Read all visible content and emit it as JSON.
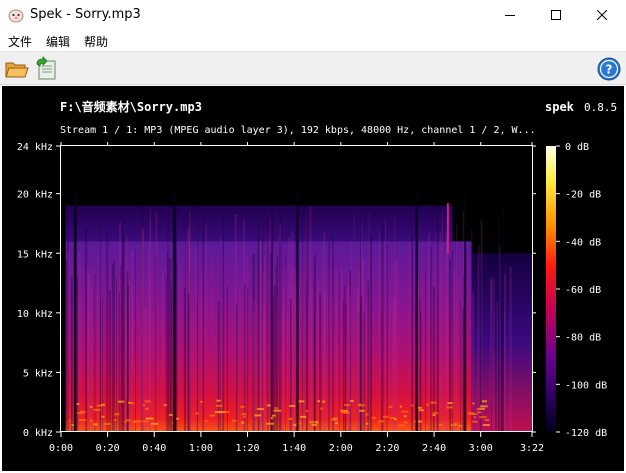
{
  "window": {
    "title": "Spek - Sorry.mp3"
  },
  "menu": {
    "items": [
      "文件",
      "编辑",
      "帮助"
    ]
  },
  "toolbar": {
    "open_icon": "folder-open-icon",
    "save_icon": "save-icon",
    "help_icon": "help-icon"
  },
  "spectrogram": {
    "file_label": "F:\\音频素材\\Sorry.mp3",
    "info_line": "Stream 1 / 1: MP3 (MPEG audio layer 3), 192 kbps, 48000 Hz, channel 1 / 2, W...",
    "brand": "spek",
    "version": "0.8.5",
    "freq_ticks": [
      "24 kHz",
      "20 kHz",
      "15 kHz",
      "10 kHz",
      "5 kHz",
      "0 kHz"
    ],
    "time_ticks": [
      "0:00",
      "0:20",
      "0:40",
      "1:00",
      "1:20",
      "1:40",
      "2:00",
      "2:20",
      "2:40",
      "3:00",
      "3:22"
    ],
    "db_ticks": [
      "0 dB",
      "-20 dB",
      "-40 dB",
      "-60 dB",
      "-80 dB",
      "-100 dB",
      "-120 dB"
    ],
    "colors": {
      "background": "#000000",
      "scale_top": "#ffffe0",
      "scale_high": "#ffd000",
      "scale_mid": "#ff2000",
      "scale_low": "#a0005a",
      "scale_lower": "#400090",
      "scale_bottom": "#000010"
    }
  }
}
